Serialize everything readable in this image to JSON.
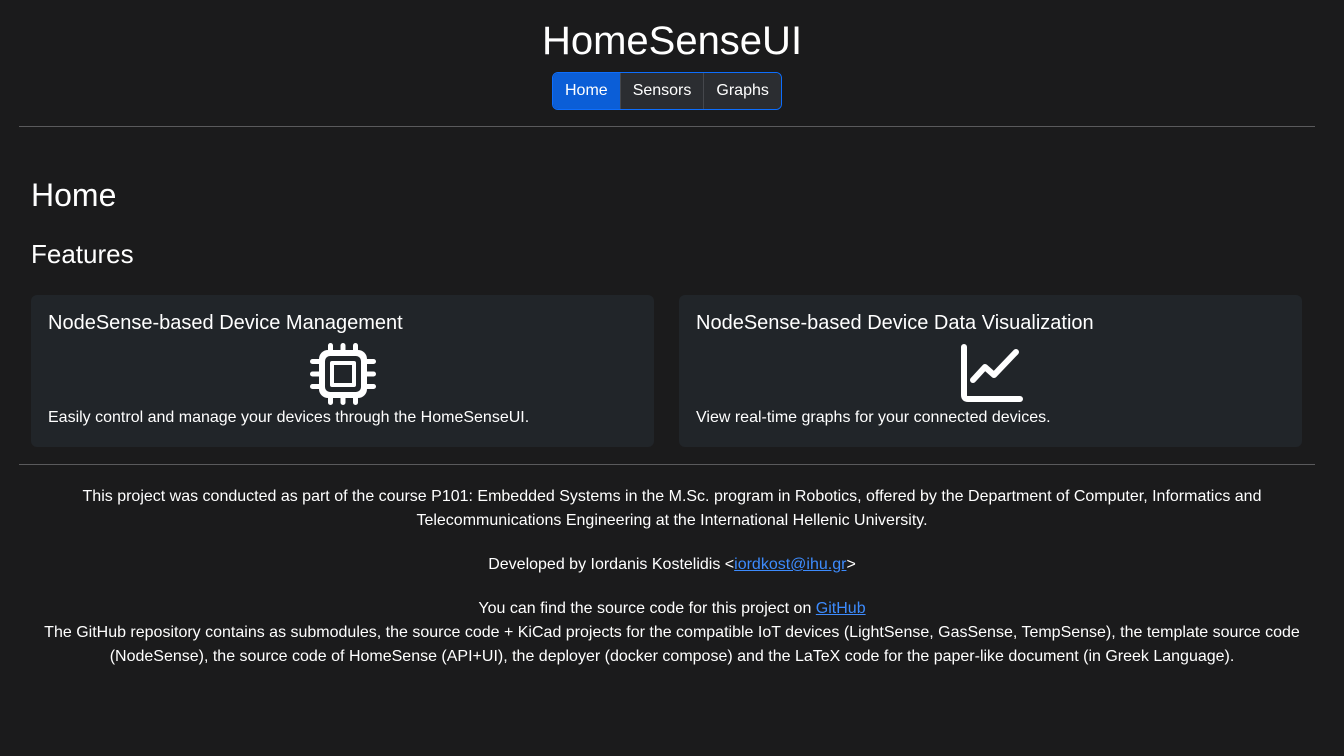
{
  "app": {
    "title": "HomeSenseUI"
  },
  "nav": {
    "items": [
      {
        "label": "Home",
        "active": true
      },
      {
        "label": "Sensors",
        "active": false
      },
      {
        "label": "Graphs",
        "active": false
      }
    ]
  },
  "main": {
    "heading": "Home",
    "features_heading": "Features",
    "cards": [
      {
        "title": "NodeSense-based Device Management",
        "icon": "cpu-chip-icon",
        "text": "Easily control and manage your devices through the HomeSenseUI."
      },
      {
        "title": "NodeSense-based Device Data Visualization",
        "icon": "line-chart-icon",
        "text": "View real-time graphs for your connected devices."
      }
    ]
  },
  "footer": {
    "course_line1": "This project was conducted as part of the course P101: Embedded Systems in the M.Sc. program in Robotics, offered by the Department of Computer, Informatics and",
    "course_line2": "Telecommunications Engineering at the International Hellenic University.",
    "dev_prefix": "Developed by Iordanis Kostelidis <",
    "dev_email": "iordkost@ihu.gr",
    "dev_suffix": ">",
    "source_prefix": "You can find the source code for this project on ",
    "source_link": "GitHub",
    "repo_line1": "The GitHub repository contains as submodules, the source code + KiCad projects for the compatible IoT devices (LightSense, GasSense, TempSense), the template source code",
    "repo_line2": "(NodeSense), the source code of HomeSense (API+UI), the deployer (docker compose) and the LaTeX code for the paper-like document (in Greek Language)."
  },
  "colors": {
    "background": "#1b1b1c",
    "card": "#212529",
    "accent": "#0b5ed7",
    "link": "#3d8bfd"
  }
}
